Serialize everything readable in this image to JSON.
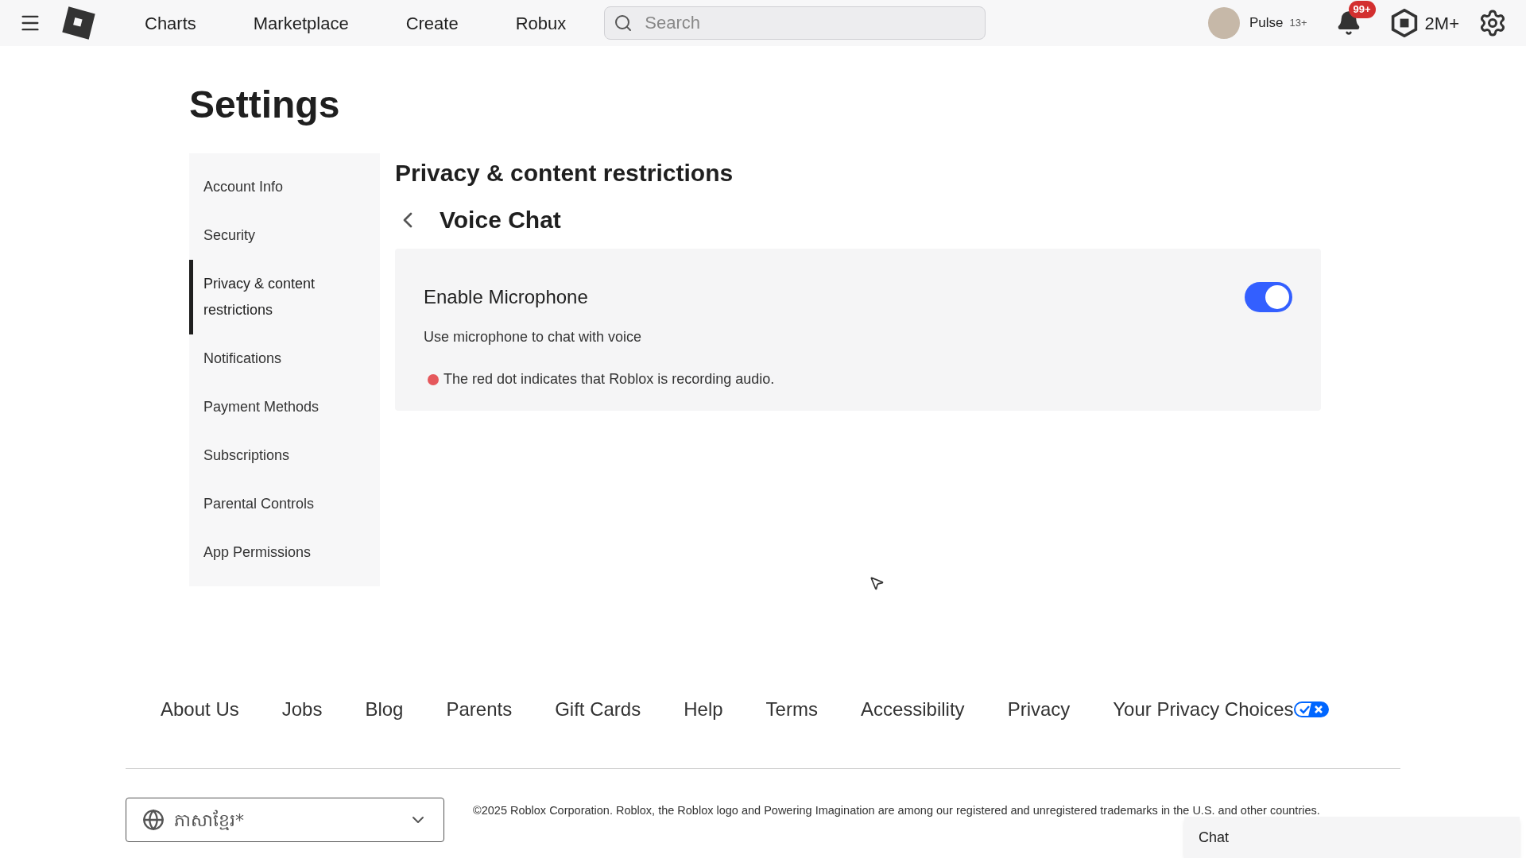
{
  "top_nav": {
    "links": [
      "Charts",
      "Marketplace",
      "Create",
      "Robux"
    ],
    "search": {
      "placeholder": "Search"
    },
    "user": {
      "name": "Pulse",
      "age_badge": "13+"
    },
    "notifications": {
      "count": "99+"
    },
    "robux": {
      "amount": "2M+"
    }
  },
  "page_title": "Settings",
  "sidebar": {
    "items": [
      {
        "label": "Account Info",
        "selected": false
      },
      {
        "label": "Security",
        "selected": false
      },
      {
        "label": "Privacy & content restrictions",
        "selected": true
      },
      {
        "label": "Notifications",
        "selected": false
      },
      {
        "label": "Payment Methods",
        "selected": false
      },
      {
        "label": "Subscriptions",
        "selected": false
      },
      {
        "label": "Parental Controls",
        "selected": false
      },
      {
        "label": "App Permissions",
        "selected": false
      }
    ]
  },
  "section_title": "Privacy & content restrictions",
  "subsection_title": "Voice Chat",
  "setting": {
    "title": "Enable Microphone",
    "on": true,
    "description": "Use microphone to chat with voice",
    "note": "The red dot indicates that Roblox is recording audio."
  },
  "footer": {
    "links": [
      "About Us",
      "Jobs",
      "Blog",
      "Parents",
      "Gift Cards",
      "Help",
      "Terms",
      "Accessibility",
      "Privacy",
      "Your Privacy Choices"
    ],
    "language": "ភាសាខ្មែរ*",
    "copyright": "©2025 Roblox Corporation. Roblox, the Roblox logo and Powering Imagination are among our registered and unregistered trademarks in the U.S. and other countries."
  },
  "chat": {
    "label": "Chat"
  }
}
